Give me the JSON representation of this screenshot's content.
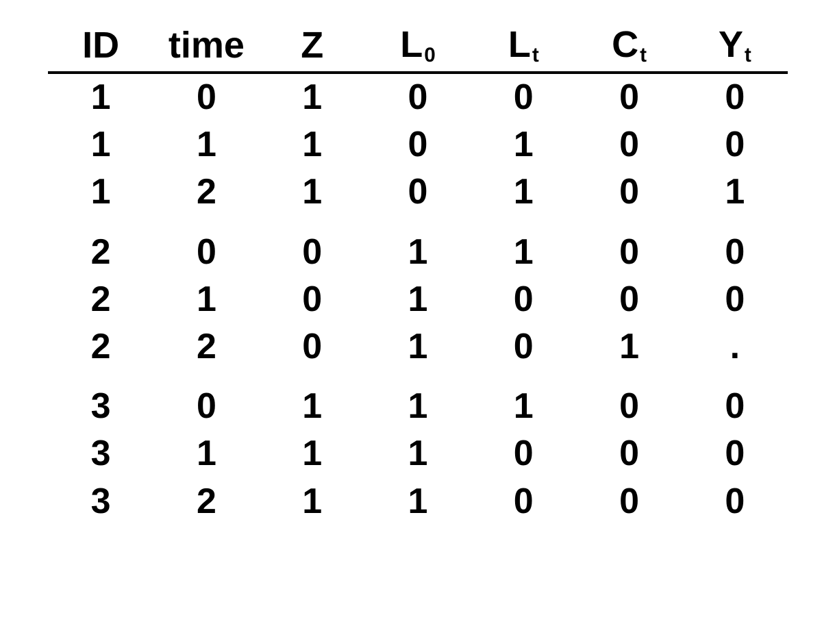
{
  "chart_data": {
    "type": "table",
    "columns": [
      "ID",
      "time",
      "Z",
      "L0",
      "Lt",
      "Ct",
      "Yt"
    ],
    "column_labels": {
      "ID": {
        "base": "ID",
        "sub": ""
      },
      "time": {
        "base": "time",
        "sub": ""
      },
      "Z": {
        "base": "Z",
        "sub": ""
      },
      "L0": {
        "base": "L",
        "sub": "0"
      },
      "Lt": {
        "base": "L",
        "sub": "t"
      },
      "Ct": {
        "base": "C",
        "sub": "t"
      },
      "Yt": {
        "base": "Y",
        "sub": "t"
      }
    },
    "rows": [
      {
        "ID": "1",
        "time": "0",
        "Z": "1",
        "L0": "0",
        "Lt": "0",
        "Ct": "0",
        "Yt": "0"
      },
      {
        "ID": "1",
        "time": "1",
        "Z": "1",
        "L0": "0",
        "Lt": "1",
        "Ct": "0",
        "Yt": "0"
      },
      {
        "ID": "1",
        "time": "2",
        "Z": "1",
        "L0": "0",
        "Lt": "1",
        "Ct": "0",
        "Yt": "1"
      },
      {
        "ID": "2",
        "time": "0",
        "Z": "0",
        "L0": "1",
        "Lt": "1",
        "Ct": "0",
        "Yt": "0"
      },
      {
        "ID": "2",
        "time": "1",
        "Z": "0",
        "L0": "1",
        "Lt": "0",
        "Ct": "0",
        "Yt": "0"
      },
      {
        "ID": "2",
        "time": "2",
        "Z": "0",
        "L0": "1",
        "Lt": "0",
        "Ct": "1",
        "Yt": "."
      },
      {
        "ID": "3",
        "time": "0",
        "Z": "1",
        "L0": "1",
        "Lt": "1",
        "Ct": "0",
        "Yt": "0"
      },
      {
        "ID": "3",
        "time": "1",
        "Z": "1",
        "L0": "1",
        "Lt": "0",
        "Ct": "0",
        "Yt": "0"
      },
      {
        "ID": "3",
        "time": "2",
        "Z": "1",
        "L0": "1",
        "Lt": "0",
        "Ct": "0",
        "Yt": "0"
      }
    ]
  }
}
